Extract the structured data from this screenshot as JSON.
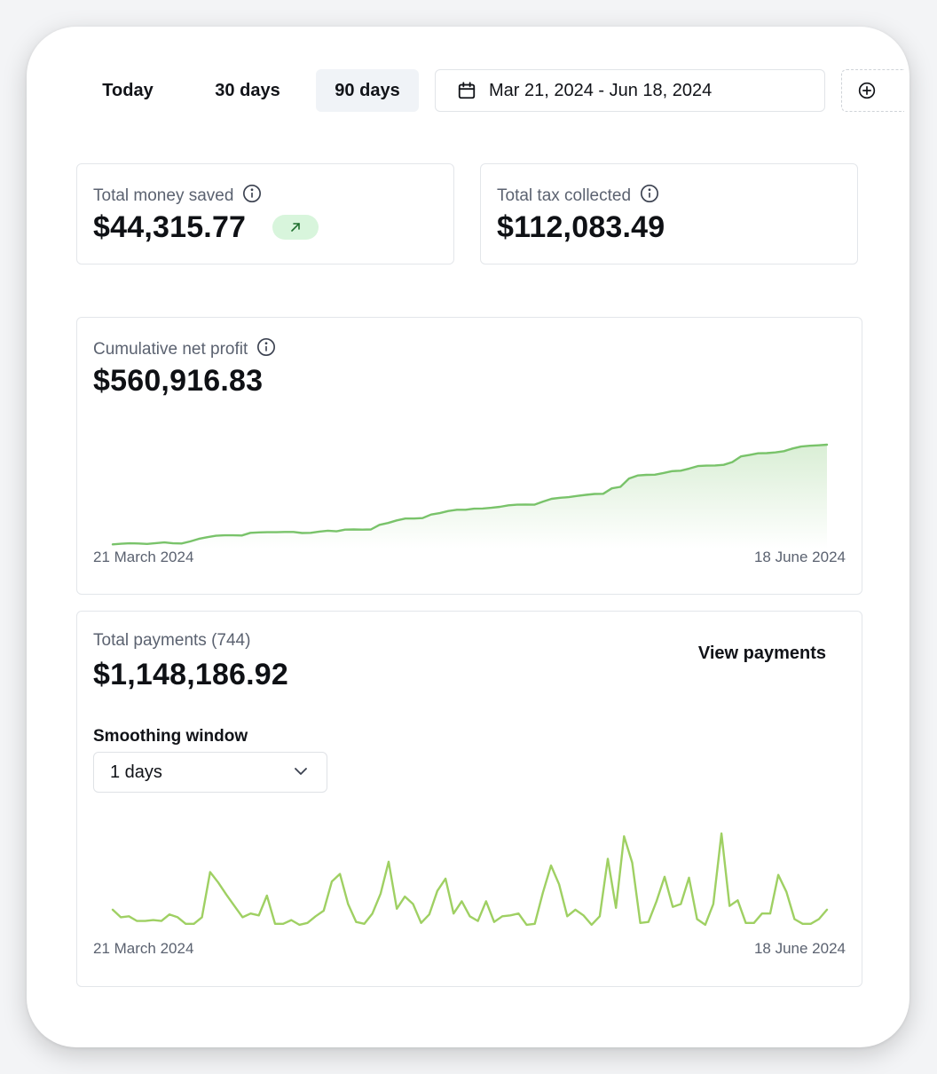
{
  "range": {
    "buttons": [
      {
        "label": "Today",
        "active": false
      },
      {
        "label": "30 days",
        "active": false
      },
      {
        "label": "90 days",
        "active": true
      }
    ],
    "date_range": "Mar 21, 2024 - Jun 18, 2024"
  },
  "metrics": {
    "money_saved": {
      "label": "Total money saved",
      "value": "$44,315.77"
    },
    "tax_collected": {
      "label": "Total tax collected",
      "value": "$112,083.49"
    }
  },
  "profit": {
    "label": "Cumulative net profit",
    "value": "$560,916.83",
    "start_label": "21 March 2024",
    "end_label": "18 June 2024"
  },
  "payments": {
    "label": "Total payments (744)",
    "value": "$1,148,186.92",
    "view_link": "View payments",
    "smoothing_label": "Smoothing window",
    "smoothing_value": "1 days",
    "start_label": "21 March 2024",
    "end_label": "18 June 2024"
  },
  "colors": {
    "line": "#79c36a",
    "payments_line": "#9fd063",
    "badge_bg": "#d8f5dc",
    "active_bg": "#f0f3f7"
  },
  "chart_data": [
    {
      "type": "area",
      "name_hint": "cumulative-net-profit",
      "values": [
        2,
        2.3,
        2.5,
        2.4,
        2.2,
        2.6,
        2.9,
        2.5,
        2.4,
        3.4,
        4.6,
        5.4,
        6.1,
        6.3,
        6.3,
        6.2,
        7.5,
        7.7,
        7.8,
        7.8,
        7.9,
        7.9,
        7.4,
        7.5,
        8.1,
        8.5,
        8.2,
        9.0,
        9.1,
        9.0,
        9.1,
        11.3,
        12.2,
        13.4,
        14.3,
        14.3,
        14.5,
        16.2,
        16.9,
        17.9,
        18.5,
        18.5,
        19.0,
        19.1,
        19.4,
        19.9,
        20.6,
        20.9,
        21.0,
        20.9,
        22.4,
        23.7,
        24.2,
        24.5,
        25.1,
        25.6,
        26.0,
        26.1,
        28.7,
        29.4,
        33.4,
        34.8,
        35.1,
        35.2,
        36.0,
        36.9,
        37.1,
        38.1,
        39.3,
        39.5,
        39.6,
        39.9,
        41.2,
        43.9,
        44.6,
        45.4,
        45.5,
        45.8,
        46.4,
        47.7,
        48.6,
        49.0,
        49.2,
        49.5
      ],
      "ylim": [
        0,
        55
      ]
    },
    {
      "type": "line",
      "name_hint": "total-payments",
      "values": [
        18,
        10,
        11,
        6,
        6,
        7,
        6,
        13,
        10,
        3,
        3,
        10,
        58,
        47,
        34,
        22,
        10,
        14,
        12,
        33,
        3,
        3,
        7,
        2,
        4,
        11,
        17,
        48,
        56,
        24,
        5,
        3,
        14,
        35,
        69,
        19,
        32,
        24,
        4,
        13,
        38,
        51,
        14,
        27,
        11,
        6,
        27,
        5,
        11,
        12,
        14,
        2,
        3,
        36,
        65,
        45,
        11,
        18,
        12,
        2,
        11,
        72,
        20,
        96,
        68,
        4,
        5,
        27,
        53,
        21,
        24,
        52,
        8,
        2,
        24,
        99,
        22,
        28,
        4,
        4,
        14,
        14,
        55,
        37,
        8,
        3,
        3,
        8,
        18
      ]
    }
  ]
}
